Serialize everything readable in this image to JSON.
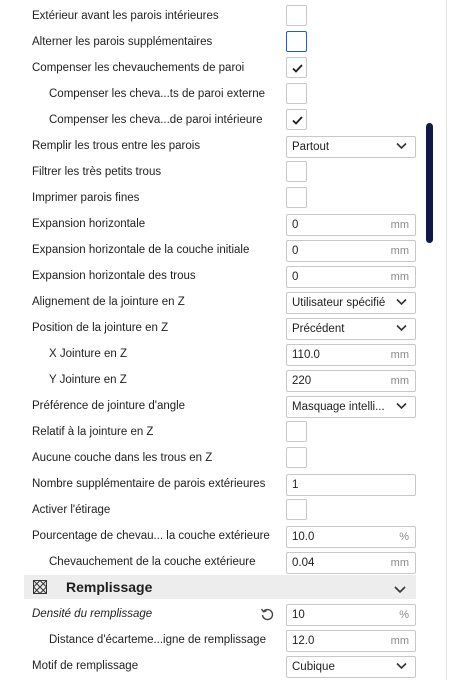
{
  "settings_top": [
    {
      "key": "outer_before_inner",
      "label": "Extérieur avant les parois intérieures",
      "control": "checkbox",
      "checked": false
    },
    {
      "key": "alternate_extra_walls",
      "label": "Alterner les parois supplémentaires",
      "control": "checkbox",
      "checked": false,
      "focused": true
    },
    {
      "key": "compensate_wall_overlaps",
      "label": "Compenser les chevauchements de paroi",
      "control": "checkbox",
      "checked": true
    },
    {
      "key": "compensate_outer_wall_overlaps",
      "label": "Compenser les cheva...ts de paroi externe",
      "control": "checkbox",
      "checked": false,
      "indent": 1
    },
    {
      "key": "compensate_inner_wall_overlaps",
      "label": "Compenser les cheva...de paroi intérieure",
      "control": "checkbox",
      "checked": true,
      "indent": 1
    },
    {
      "key": "fill_gaps_between_walls",
      "label": "Remplir les trous entre les parois",
      "control": "combo",
      "value": "Partout"
    },
    {
      "key": "filter_tiny_gaps",
      "label": "Filtrer les très petits trous",
      "control": "checkbox",
      "checked": false
    },
    {
      "key": "print_thin_walls",
      "label": "Imprimer parois fines",
      "control": "checkbox",
      "checked": false
    },
    {
      "key": "horizontal_expansion",
      "label": "Expansion horizontale",
      "control": "field",
      "value": "0",
      "unit": "mm"
    },
    {
      "key": "initial_layer_horizontal_expansion",
      "label": "Expansion horizontale de la couche initiale",
      "control": "field",
      "value": "0",
      "unit": "mm"
    },
    {
      "key": "hole_horizontal_expansion",
      "label": "Expansion horizontale des trous",
      "control": "field",
      "value": "0",
      "unit": "mm"
    },
    {
      "key": "z_seam_alignment",
      "label": "Alignement de la jointure en Z",
      "control": "combo",
      "value": "Utilisateur spécifié"
    },
    {
      "key": "z_seam_position",
      "label": "Position de la jointure en Z",
      "control": "combo",
      "value": "Précédent"
    },
    {
      "key": "z_seam_x",
      "label": "X Jointure en Z",
      "control": "field",
      "value": "110.0",
      "unit": "mm",
      "indent": 1
    },
    {
      "key": "z_seam_y",
      "label": "Y Jointure en Z",
      "control": "field",
      "value": "220",
      "unit": "mm",
      "indent": 1
    },
    {
      "key": "seam_corner_preference",
      "label": "Préférence de jointure d'angle",
      "control": "combo",
      "value": "Masquage intelli..."
    },
    {
      "key": "z_seam_relative",
      "label": "Relatif à la jointure en Z",
      "control": "checkbox",
      "checked": false
    },
    {
      "key": "no_skin_in_z_gaps",
      "label": "Aucune couche dans les trous en Z",
      "control": "checkbox",
      "checked": false
    },
    {
      "key": "extra_skin_wall_count",
      "label": "Nombre supplémentaire de parois extérieures",
      "control": "field",
      "value": "1",
      "unit": ""
    },
    {
      "key": "enable_ironing",
      "label": "Activer l'étirage",
      "control": "checkbox",
      "checked": false
    },
    {
      "key": "skin_overlap_percentage",
      "label": "Pourcentage de chevau... la couche extérieure",
      "control": "field",
      "value": "10.0",
      "unit": "%"
    },
    {
      "key": "skin_overlap",
      "label": "Chevauchement de la couche extérieure",
      "control": "field",
      "value": "0.04",
      "unit": "mm",
      "indent": 1
    }
  ],
  "infill_category": {
    "label": "Remplissage",
    "icon": "infill-icon",
    "expand_icon": "chevron-down-icon"
  },
  "settings_infill": [
    {
      "key": "infill_density",
      "label": "Densité du remplissage",
      "control": "field",
      "value": "10",
      "unit": "%",
      "italic": true,
      "reset": true
    },
    {
      "key": "infill_line_distance",
      "label": "Distance d'écarteme...igne de remplissage",
      "control": "field",
      "value": "12.0",
      "unit": "mm",
      "indent": 1
    },
    {
      "key": "infill_pattern",
      "label": "Motif de remplissage",
      "control": "combo",
      "value": "Cubique"
    }
  ],
  "colors": {
    "focus_border": "#1c5cd4",
    "scrollbar": "#0f1a4a",
    "category_bg": "#ededed",
    "unit_text": "#8a8a8a"
  }
}
